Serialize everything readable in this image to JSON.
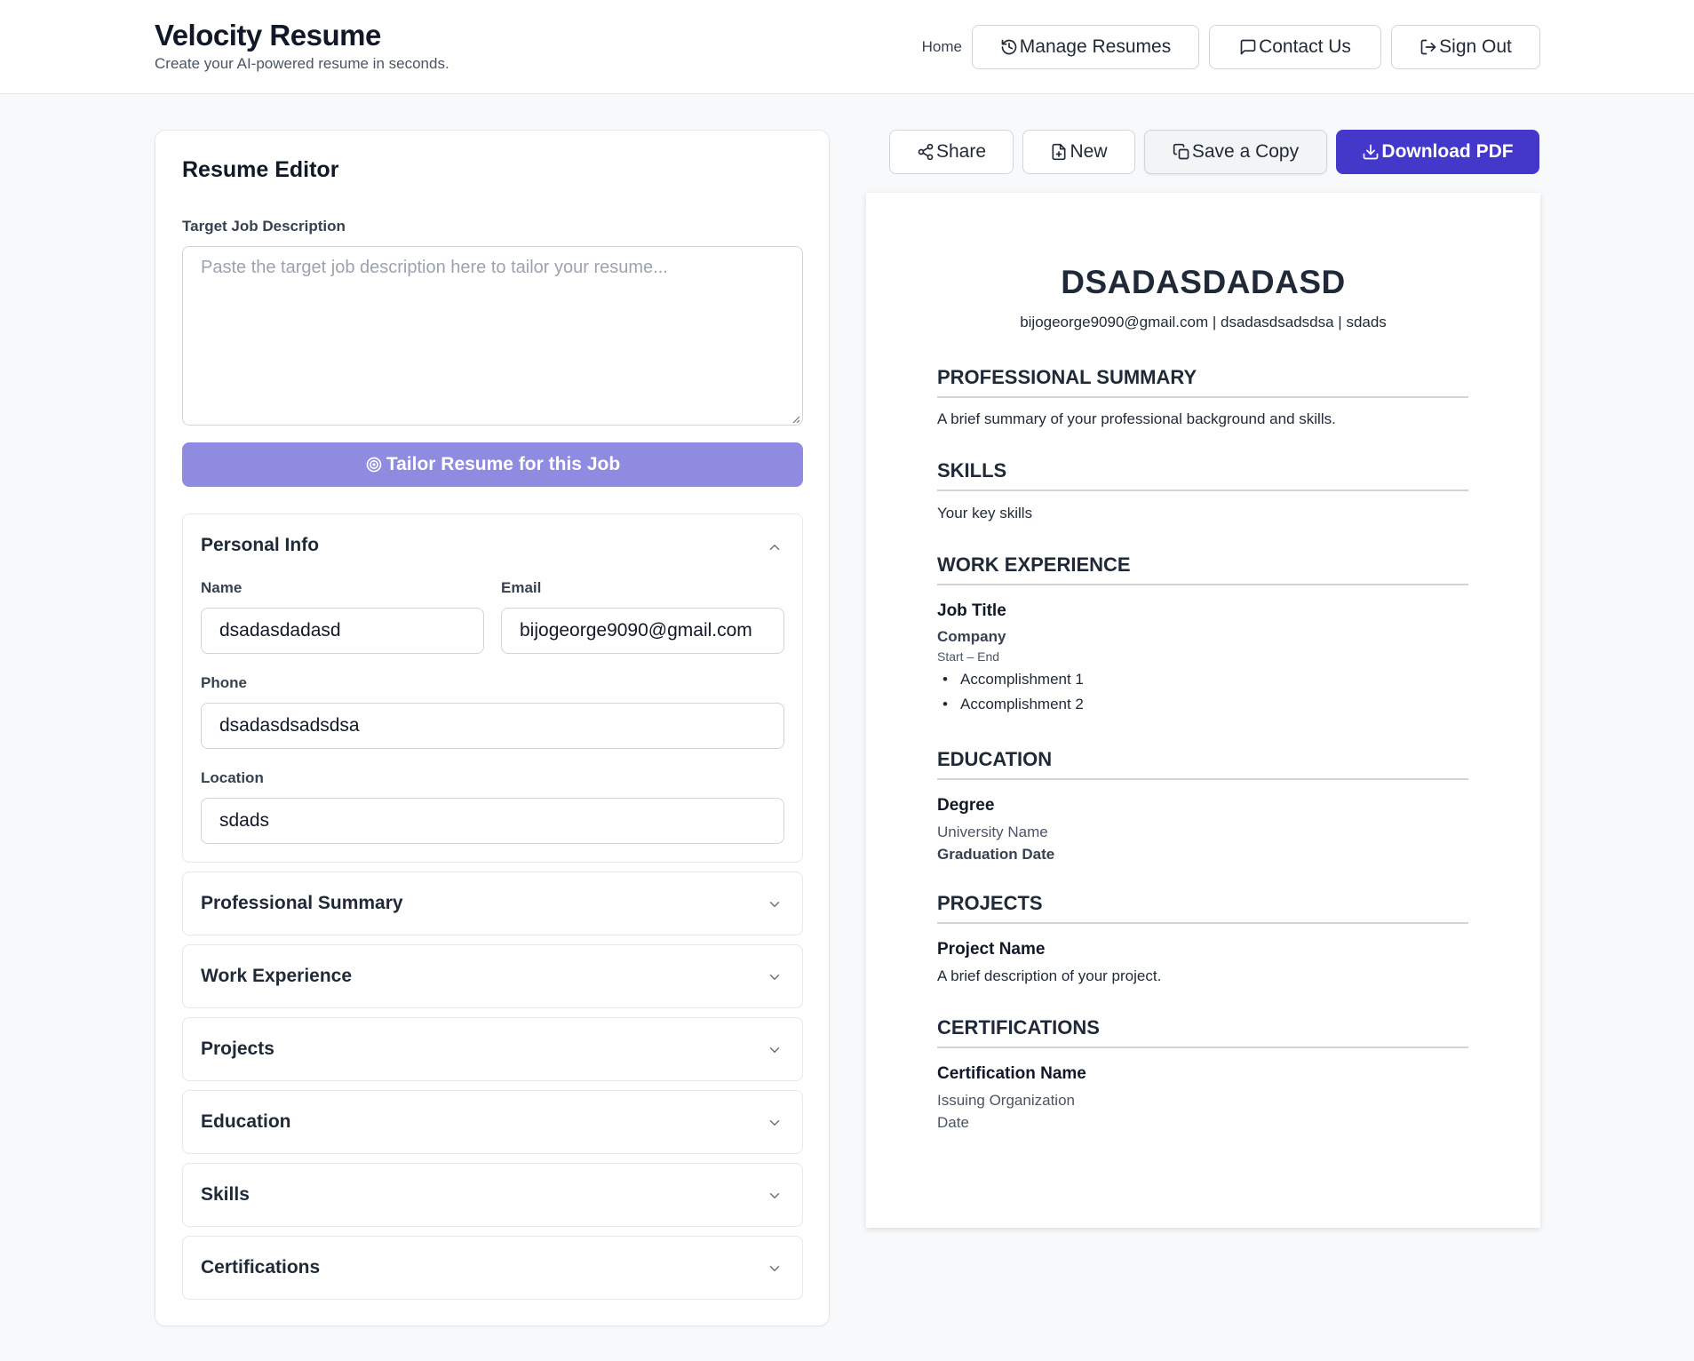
{
  "header": {
    "title": "Velocity Resume",
    "subtitle": "Create your AI-powered resume in seconds.",
    "nav": {
      "home": "Home",
      "manage": "Manage Resumes",
      "contact": "Contact Us",
      "signout": "Sign Out"
    }
  },
  "editor": {
    "title": "Resume Editor",
    "jd_label": "Target Job Description",
    "jd_placeholder": "Paste the target job description here to tailor your resume...",
    "jd_value": "",
    "tailor_button": "Tailor Resume for this Job",
    "personal": {
      "title": "Personal Info",
      "name_label": "Name",
      "name_value": "dsadasdadasd",
      "email_label": "Email",
      "email_value": "bijogeorge9090@gmail.com",
      "phone_label": "Phone",
      "phone_value": "dsadasdsadsdsa",
      "location_label": "Location",
      "location_value": "sdads"
    },
    "sections": [
      "Professional Summary",
      "Work Experience",
      "Projects",
      "Education",
      "Skills",
      "Certifications"
    ]
  },
  "actions": {
    "share": "Share",
    "new": "New",
    "copy": "Save a Copy",
    "download": "Download PDF"
  },
  "preview": {
    "name": "DSADASDADASD",
    "contact": "bijogeorge9090@gmail.com | dsadasdsadsdsa | sdads",
    "summary_heading": "PROFESSIONAL SUMMARY",
    "summary_text": "A brief summary of your professional background and skills.",
    "skills_heading": "SKILLS",
    "skills_text": "Your key skills",
    "work_heading": "WORK EXPERIENCE",
    "job_title": "Job Title",
    "company": "Company",
    "dates": "Start – End",
    "accomplishments": [
      "Accomplishment 1",
      "Accomplishment 2"
    ],
    "education_heading": "EDUCATION",
    "degree": "Degree",
    "university": "University Name",
    "grad_date": "Graduation Date",
    "projects_heading": "PROJECTS",
    "project_name": "Project Name",
    "project_desc": "A brief description of your project.",
    "cert_heading": "CERTIFICATIONS",
    "cert_name": "Certification Name",
    "cert_org": "Issuing Organization",
    "cert_date": "Date"
  },
  "colors": {
    "primary": "#4338ca",
    "primary_light": "#8e8be0",
    "text": "#1f2937",
    "border": "#e5e7eb",
    "background": "#f8f9fb"
  }
}
